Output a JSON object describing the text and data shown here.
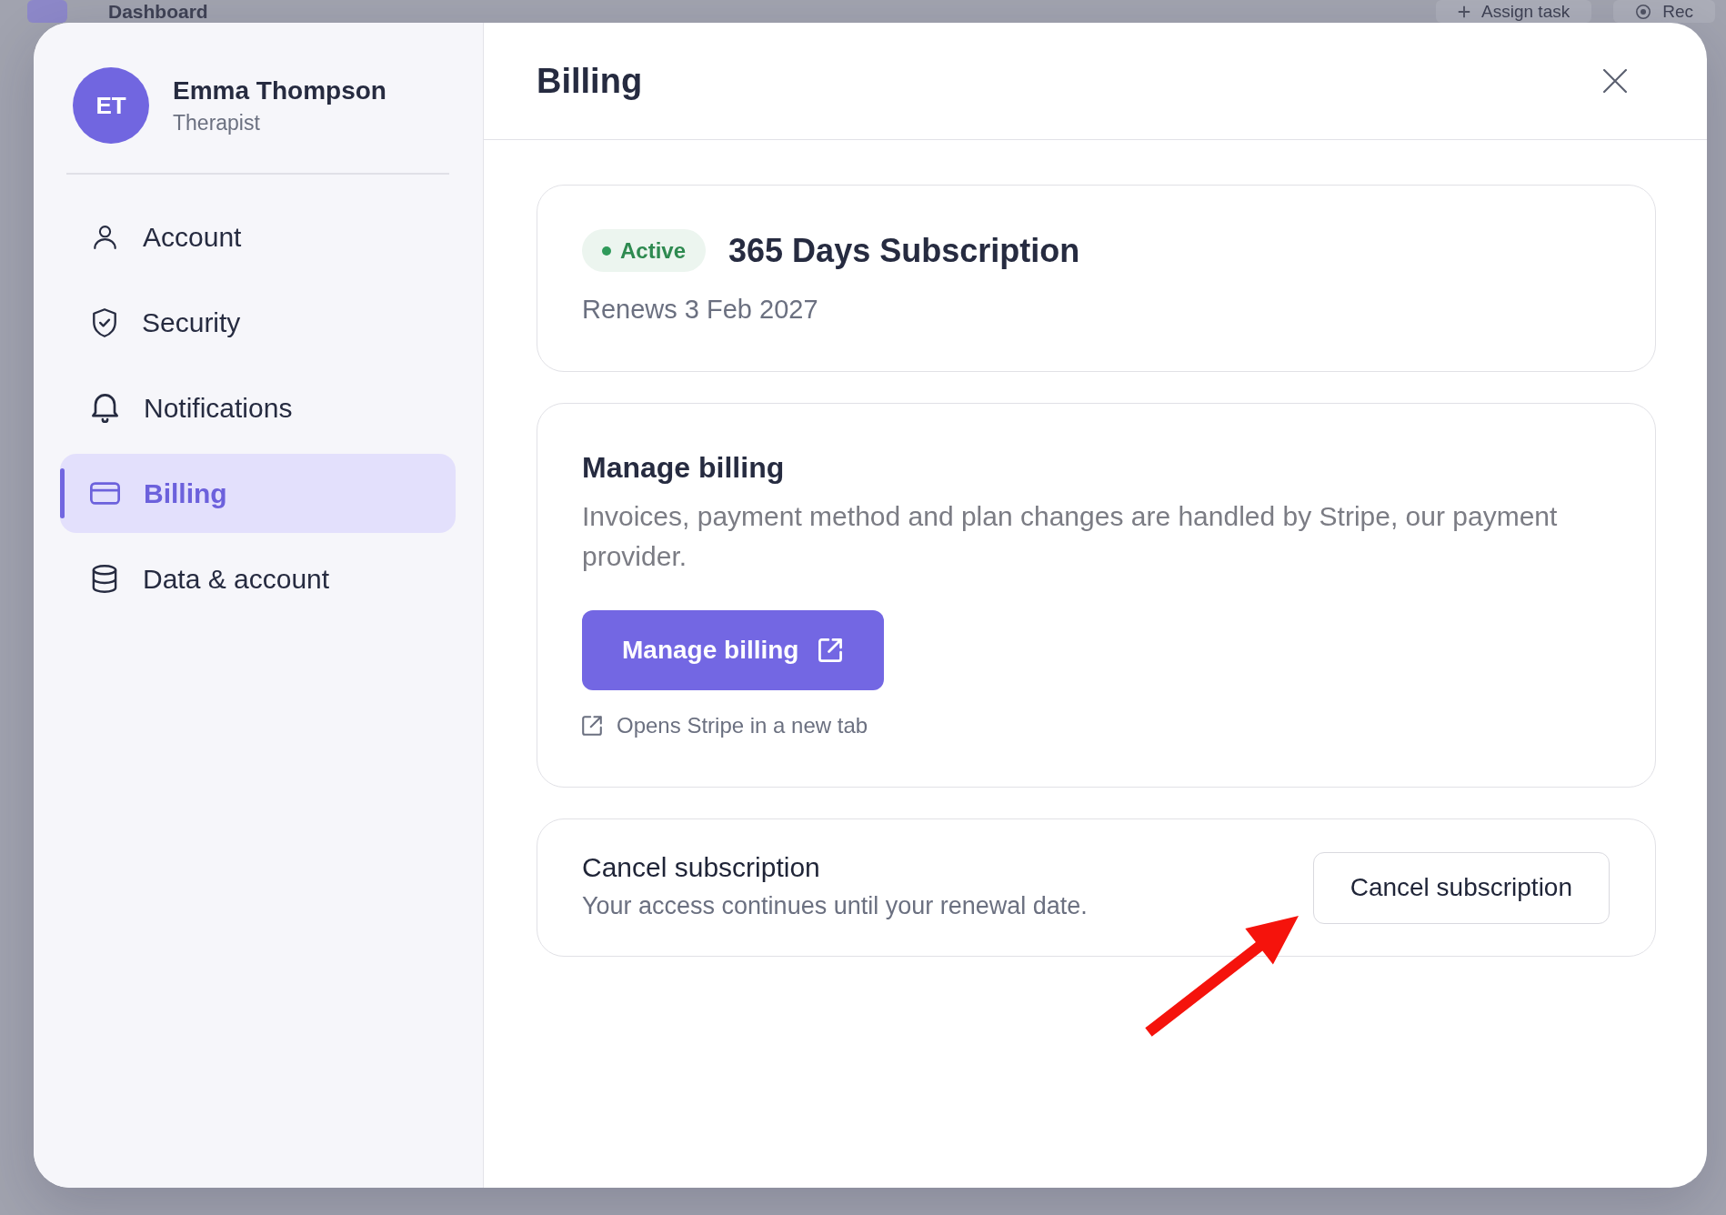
{
  "backdrop": {
    "title": "Dashboard",
    "actions": [
      "Assign task",
      "Rec"
    ]
  },
  "profile": {
    "initials": "ET",
    "name": "Emma Thompson",
    "role": "Therapist"
  },
  "nav": [
    {
      "label": "Account",
      "selected": false
    },
    {
      "label": "Security",
      "selected": false
    },
    {
      "label": "Notifications",
      "selected": false
    },
    {
      "label": "Billing",
      "selected": true
    },
    {
      "label": "Data & account",
      "selected": false
    }
  ],
  "header": {
    "title": "Billing"
  },
  "subscription": {
    "status": "Active",
    "plan": "365 Days Subscription",
    "renewal": "Renews 3 Feb 2027"
  },
  "manage_billing": {
    "title": "Manage billing",
    "description": "Invoices, payment method and plan changes are handled by Stripe, our payment provider.",
    "button": "Manage billing",
    "note": "Opens Stripe in a new tab"
  },
  "cancel_subscription": {
    "title": "Cancel subscription",
    "description": "Your access continues until your renewal date.",
    "button": "Cancel subscription"
  }
}
